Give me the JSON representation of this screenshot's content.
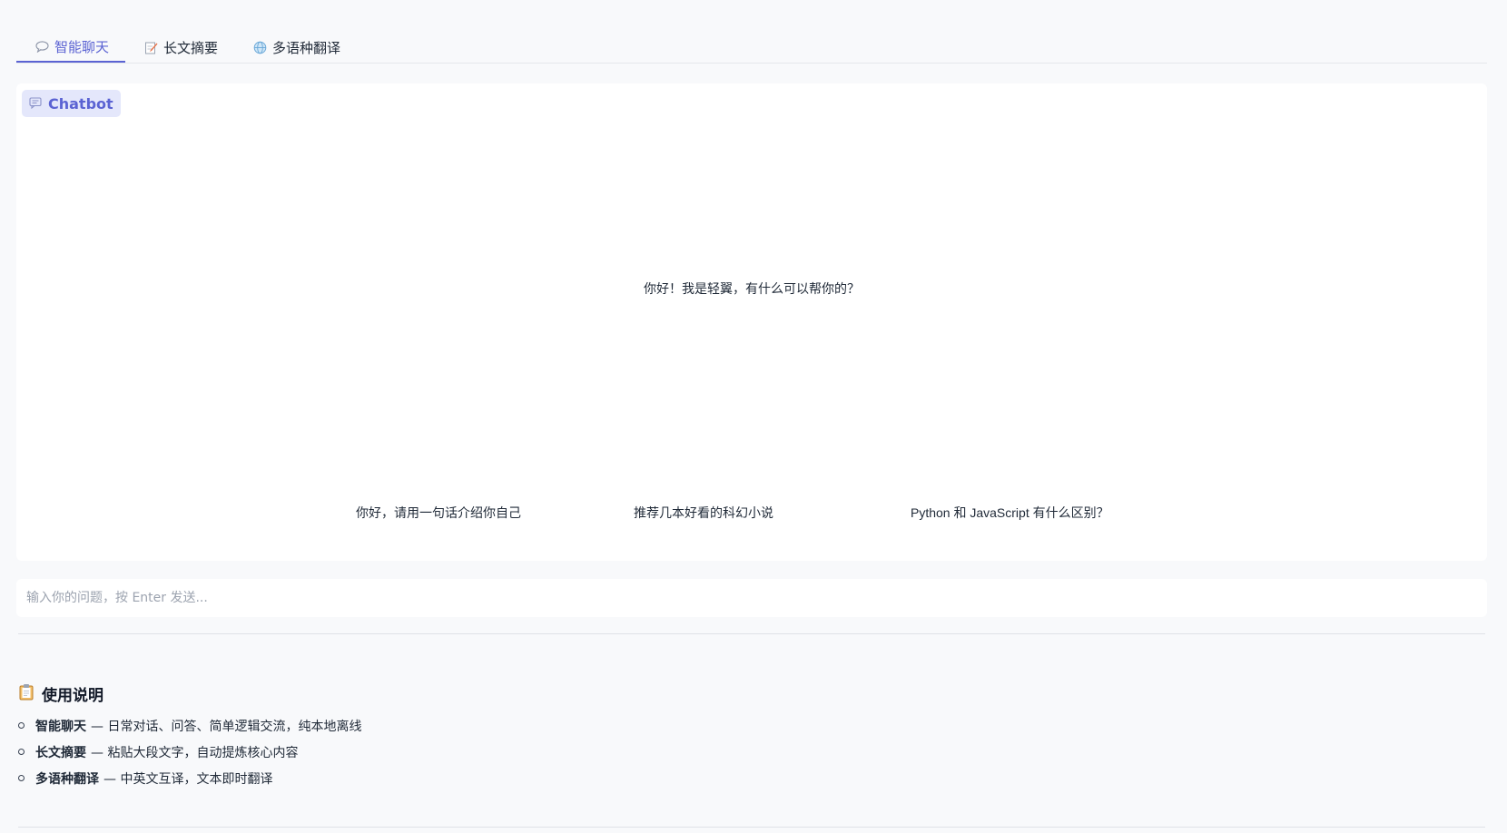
{
  "tabs": [
    {
      "label": "智能聊天",
      "icon": "speech-bubble-icon",
      "active": true
    },
    {
      "label": "长文摘要",
      "icon": "memo-icon",
      "active": false
    },
    {
      "label": "多语种翻译",
      "icon": "globe-icon",
      "active": false
    }
  ],
  "chatbot": {
    "label": "Chatbot",
    "welcome": "你好！我是轻翼，有什么可以帮你的？",
    "suggestions": [
      "你好，请用一句话介绍你自己",
      "推荐几本好看的科幻小说",
      "Python 和 JavaScript 有什么区别？"
    ]
  },
  "input": {
    "placeholder": "输入你的问题，按 Enter 发送...",
    "value": ""
  },
  "usage": {
    "title": "使用说明",
    "items": [
      {
        "name": "智能聊天",
        "desc": "— 日常对话、问答、简单逻辑交流，纯本地离线"
      },
      {
        "name": "长文摘要",
        "desc": "— 粘贴大段文字，自动提炼核心内容"
      },
      {
        "name": "多语种翻译",
        "desc": "— 中英文互译，文本即时翻译"
      }
    ]
  },
  "colors": {
    "accent": "#5b63d3",
    "accent_bg": "#e4e7fb",
    "page_bg": "#f8f9fb"
  }
}
